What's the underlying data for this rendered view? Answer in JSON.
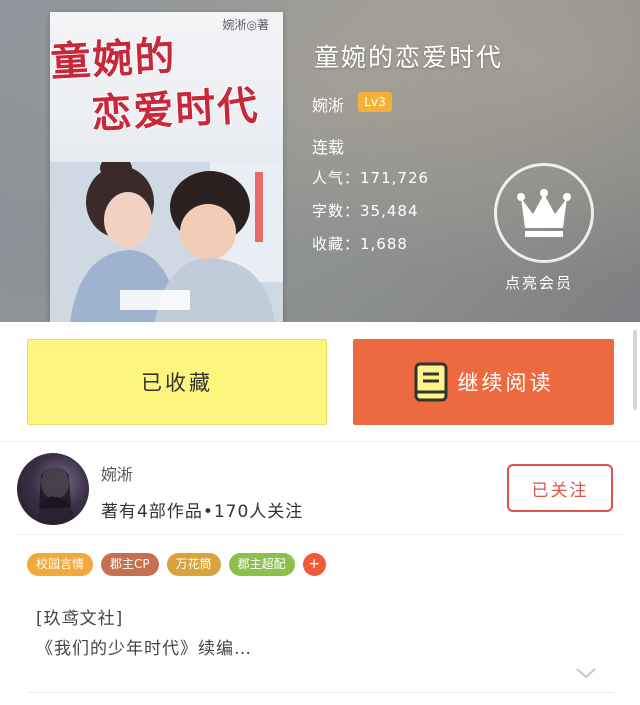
{
  "book": {
    "cover": {
      "title_line1": "童婉的",
      "title_line2": "恋爱时代",
      "author_mark": "婉淅◎著"
    },
    "title": "童婉的恋爱时代",
    "author": "婉淅",
    "level": "Lv3",
    "status": "连载",
    "stats": {
      "popularity": "人气：171,726",
      "words": "字数：35,484",
      "favorites": "收藏：1,688"
    },
    "vip_label": "点亮会员"
  },
  "actions": {
    "favorite_label": "已收藏",
    "read_label": "继续阅读"
  },
  "author_card": {
    "name": "婉淅",
    "meta": "著有4部作品•170人关注",
    "follow_label": "已关注"
  },
  "tags": [
    {
      "label": "校园言情",
      "color": "#f0a93a"
    },
    {
      "label": "郡主CP",
      "color": "#c7704f"
    },
    {
      "label": "万花筒",
      "color": "#d9a33b"
    },
    {
      "label": "郡主超配",
      "color": "#8cbf4e"
    }
  ],
  "tag_more": "+",
  "intro": {
    "line1": "[玖鸢文社]",
    "line2": "《我们的少年时代》续编…"
  },
  "colors": {
    "favorite_bg": "#fdf57d",
    "read_bg": "#ed6a40",
    "follow_border": "#e0524a",
    "level_badge": "#f2b23a"
  }
}
